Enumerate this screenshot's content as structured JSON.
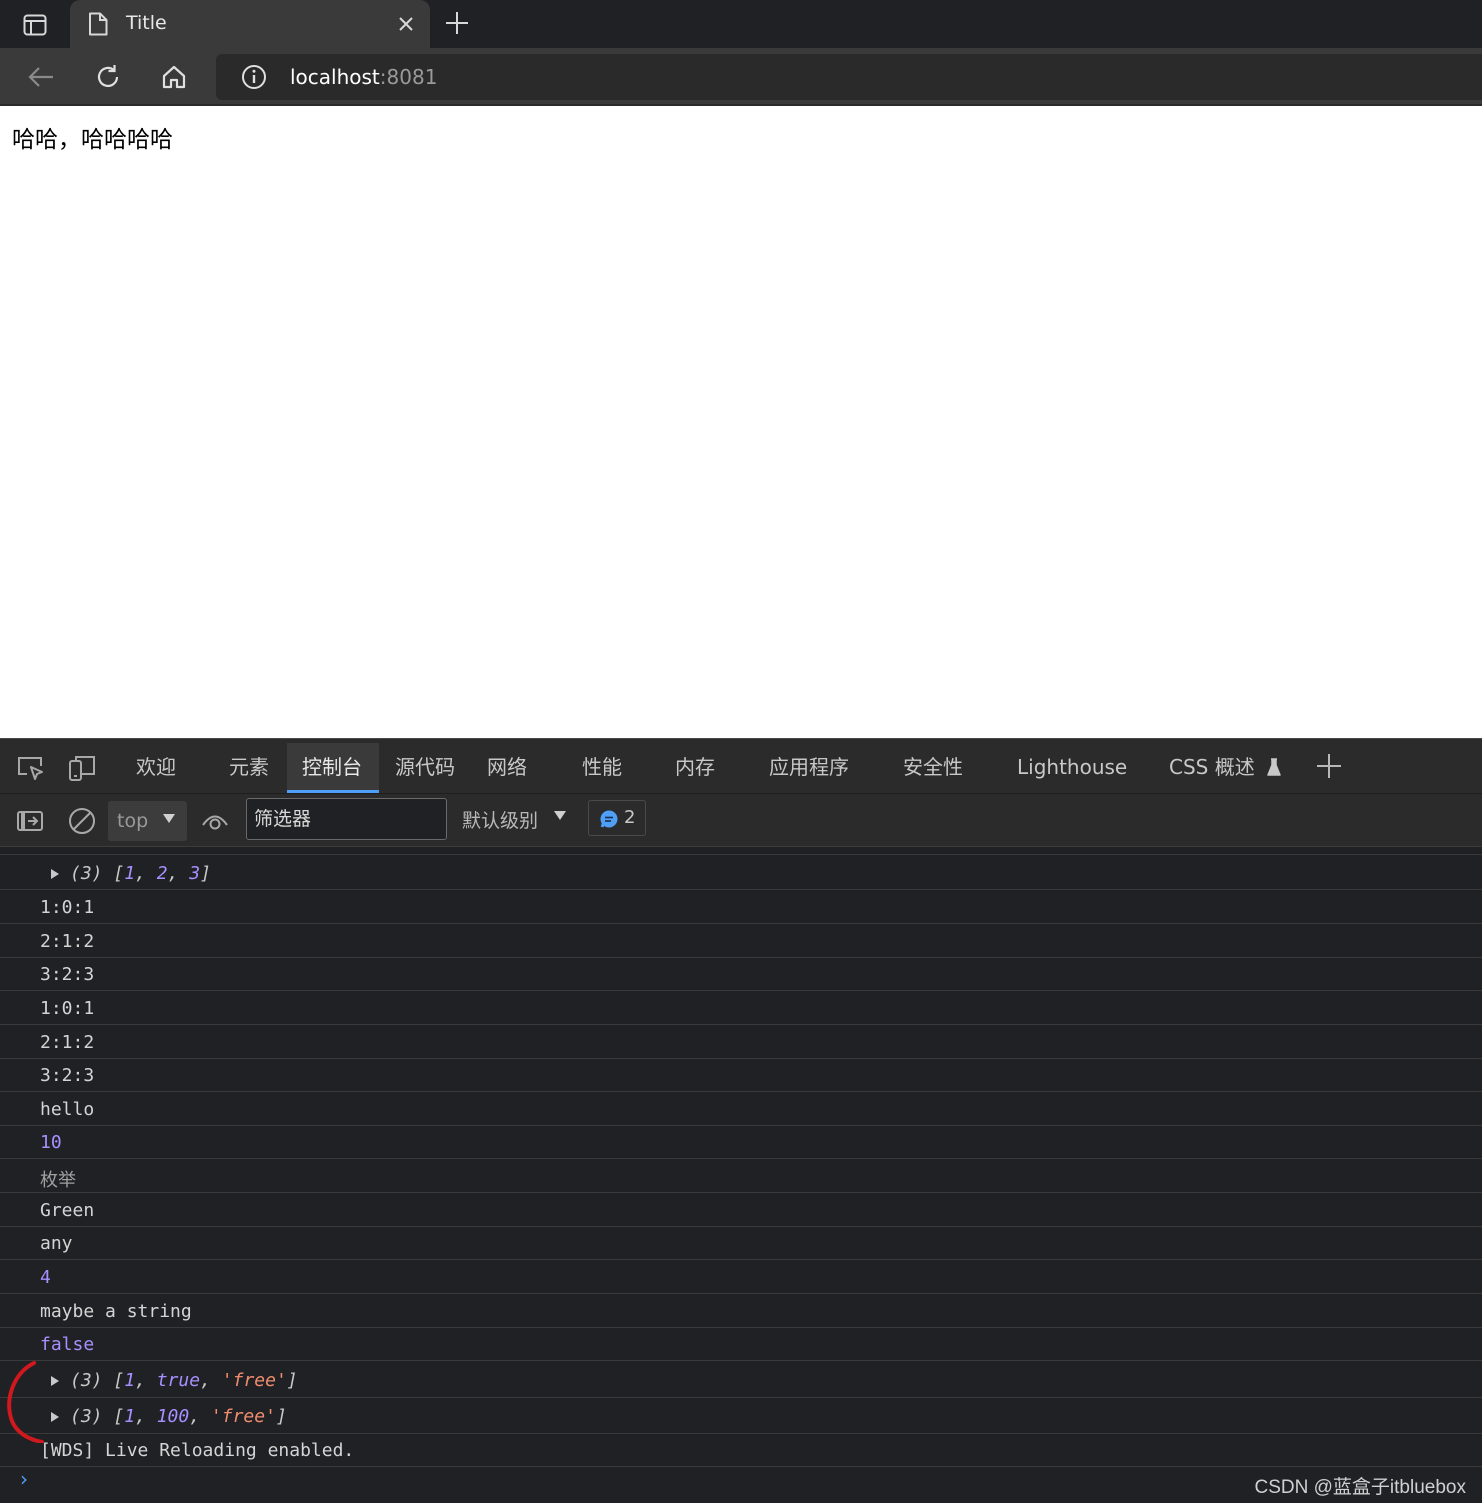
{
  "browser": {
    "tab_title": "Title",
    "url_host": "localhost",
    "url_port": ":8081"
  },
  "page": {
    "text": "哈哈，哈哈哈哈"
  },
  "devtools": {
    "tabs": [
      "欢迎",
      "元素",
      "控制台",
      "源代码",
      "网络",
      "性能",
      "内存",
      "应用程序",
      "安全性",
      "Lighthouse",
      "CSS 概述"
    ],
    "active_tab": "控制台",
    "toolbar": {
      "context": "top",
      "filter_placeholder": "筛选器",
      "level": "默认级别",
      "message_count": "2"
    },
    "console": {
      "array1": {
        "prefix": "(3) [",
        "items": [
          "1",
          "2",
          "3"
        ],
        "suffix": "]"
      },
      "lines": [
        "1:0:1",
        "2:1:2",
        "3:2:3",
        "1:0:1",
        "2:1:2",
        "3:2:3",
        "hello",
        "10",
        "枚举",
        "Green",
        "any",
        "4",
        "maybe a string",
        "false"
      ],
      "array2": {
        "prefix": "(3) [",
        "v1": "1",
        "v2": "true",
        "v3": "'free'",
        "suffix": "]"
      },
      "array3": {
        "prefix": "(3) [",
        "v1": "1",
        "v2": "100",
        "v3": "'free'",
        "suffix": "]"
      },
      "wds": "[WDS] Live Reloading enabled.",
      "prompt": "›"
    }
  },
  "watermark": "CSDN @蓝盒子itbluebox",
  "colors": {
    "accent": "#4e9ff5",
    "number": "#a88fff",
    "string": "#f08d6e",
    "annotation": "#d0191e"
  }
}
